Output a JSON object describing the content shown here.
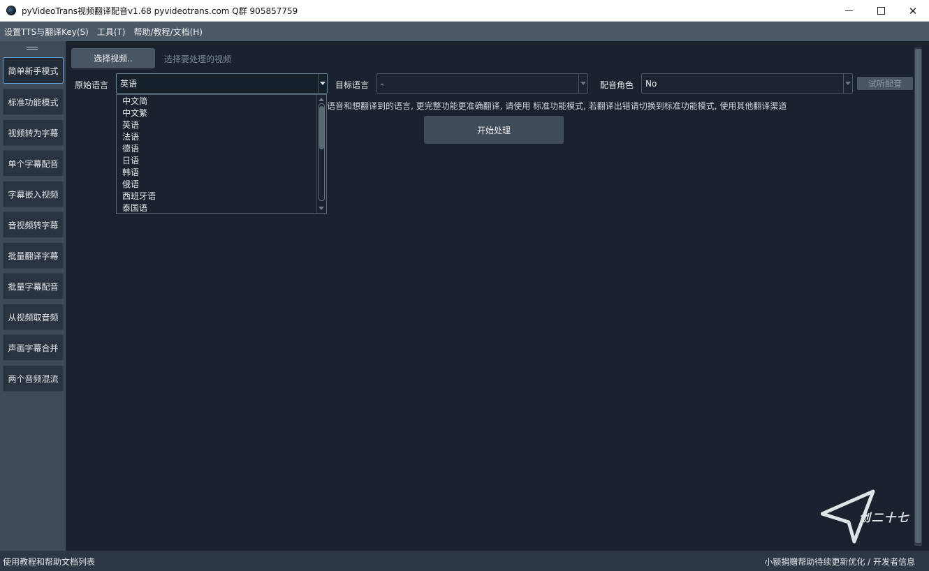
{
  "window": {
    "title": "pyVideoTrans视频翻译配音v1.68 pyvideotrans.com  Q群 905857759",
    "minimize": "—",
    "maximize": "☐",
    "close": "✕"
  },
  "menubar": {
    "items": [
      "设置TTS与翻译Key(S)",
      "工具(T)",
      "帮助/教程/文档(H)"
    ]
  },
  "sidebar": {
    "items": [
      {
        "label": "简单新手模式",
        "active": true
      },
      {
        "label": "标准功能模式",
        "active": false
      },
      {
        "label": "视频转为字幕",
        "active": false
      },
      {
        "label": "单个字幕配音",
        "active": false
      },
      {
        "label": "字幕嵌入视频",
        "active": false
      },
      {
        "label": "音视频转字幕",
        "active": false
      },
      {
        "label": "批量翻译字幕",
        "active": false
      },
      {
        "label": "批量字幕配音",
        "active": false
      },
      {
        "label": "从视频取音频",
        "active": false
      },
      {
        "label": "声画字幕合并",
        "active": false
      },
      {
        "label": "两个音频混流",
        "active": false
      }
    ]
  },
  "main": {
    "choose_video_label": "选择视频..",
    "choose_video_hint": "选择要处理的视频",
    "source_lang_label": "原始语言",
    "source_lang_value": "英语",
    "target_lang_label": "目标语言",
    "target_lang_value": "-",
    "voice_role_label": "配音角色",
    "voice_role_value": "No",
    "preview_voice_label": "试听配音",
    "note": "语音和想翻译到的语言, 更完整功能更准确翻译, 请使用 标准功能模式, 若翻译出错请切换到标准功能模式, 使用其他翻译渠道",
    "start_label": "开始处理"
  },
  "dropdown": {
    "options": [
      "中文简",
      "中文繁",
      "英语",
      "法语",
      "德语",
      "日语",
      "韩语",
      "俄语",
      "西班牙语",
      "泰国语"
    ]
  },
  "logo_text": "创二十七",
  "statusbar": {
    "left": "使用教程和帮助文档列表",
    "right": "小额捐赠帮助待续更新优化 / 开发者信息"
  }
}
